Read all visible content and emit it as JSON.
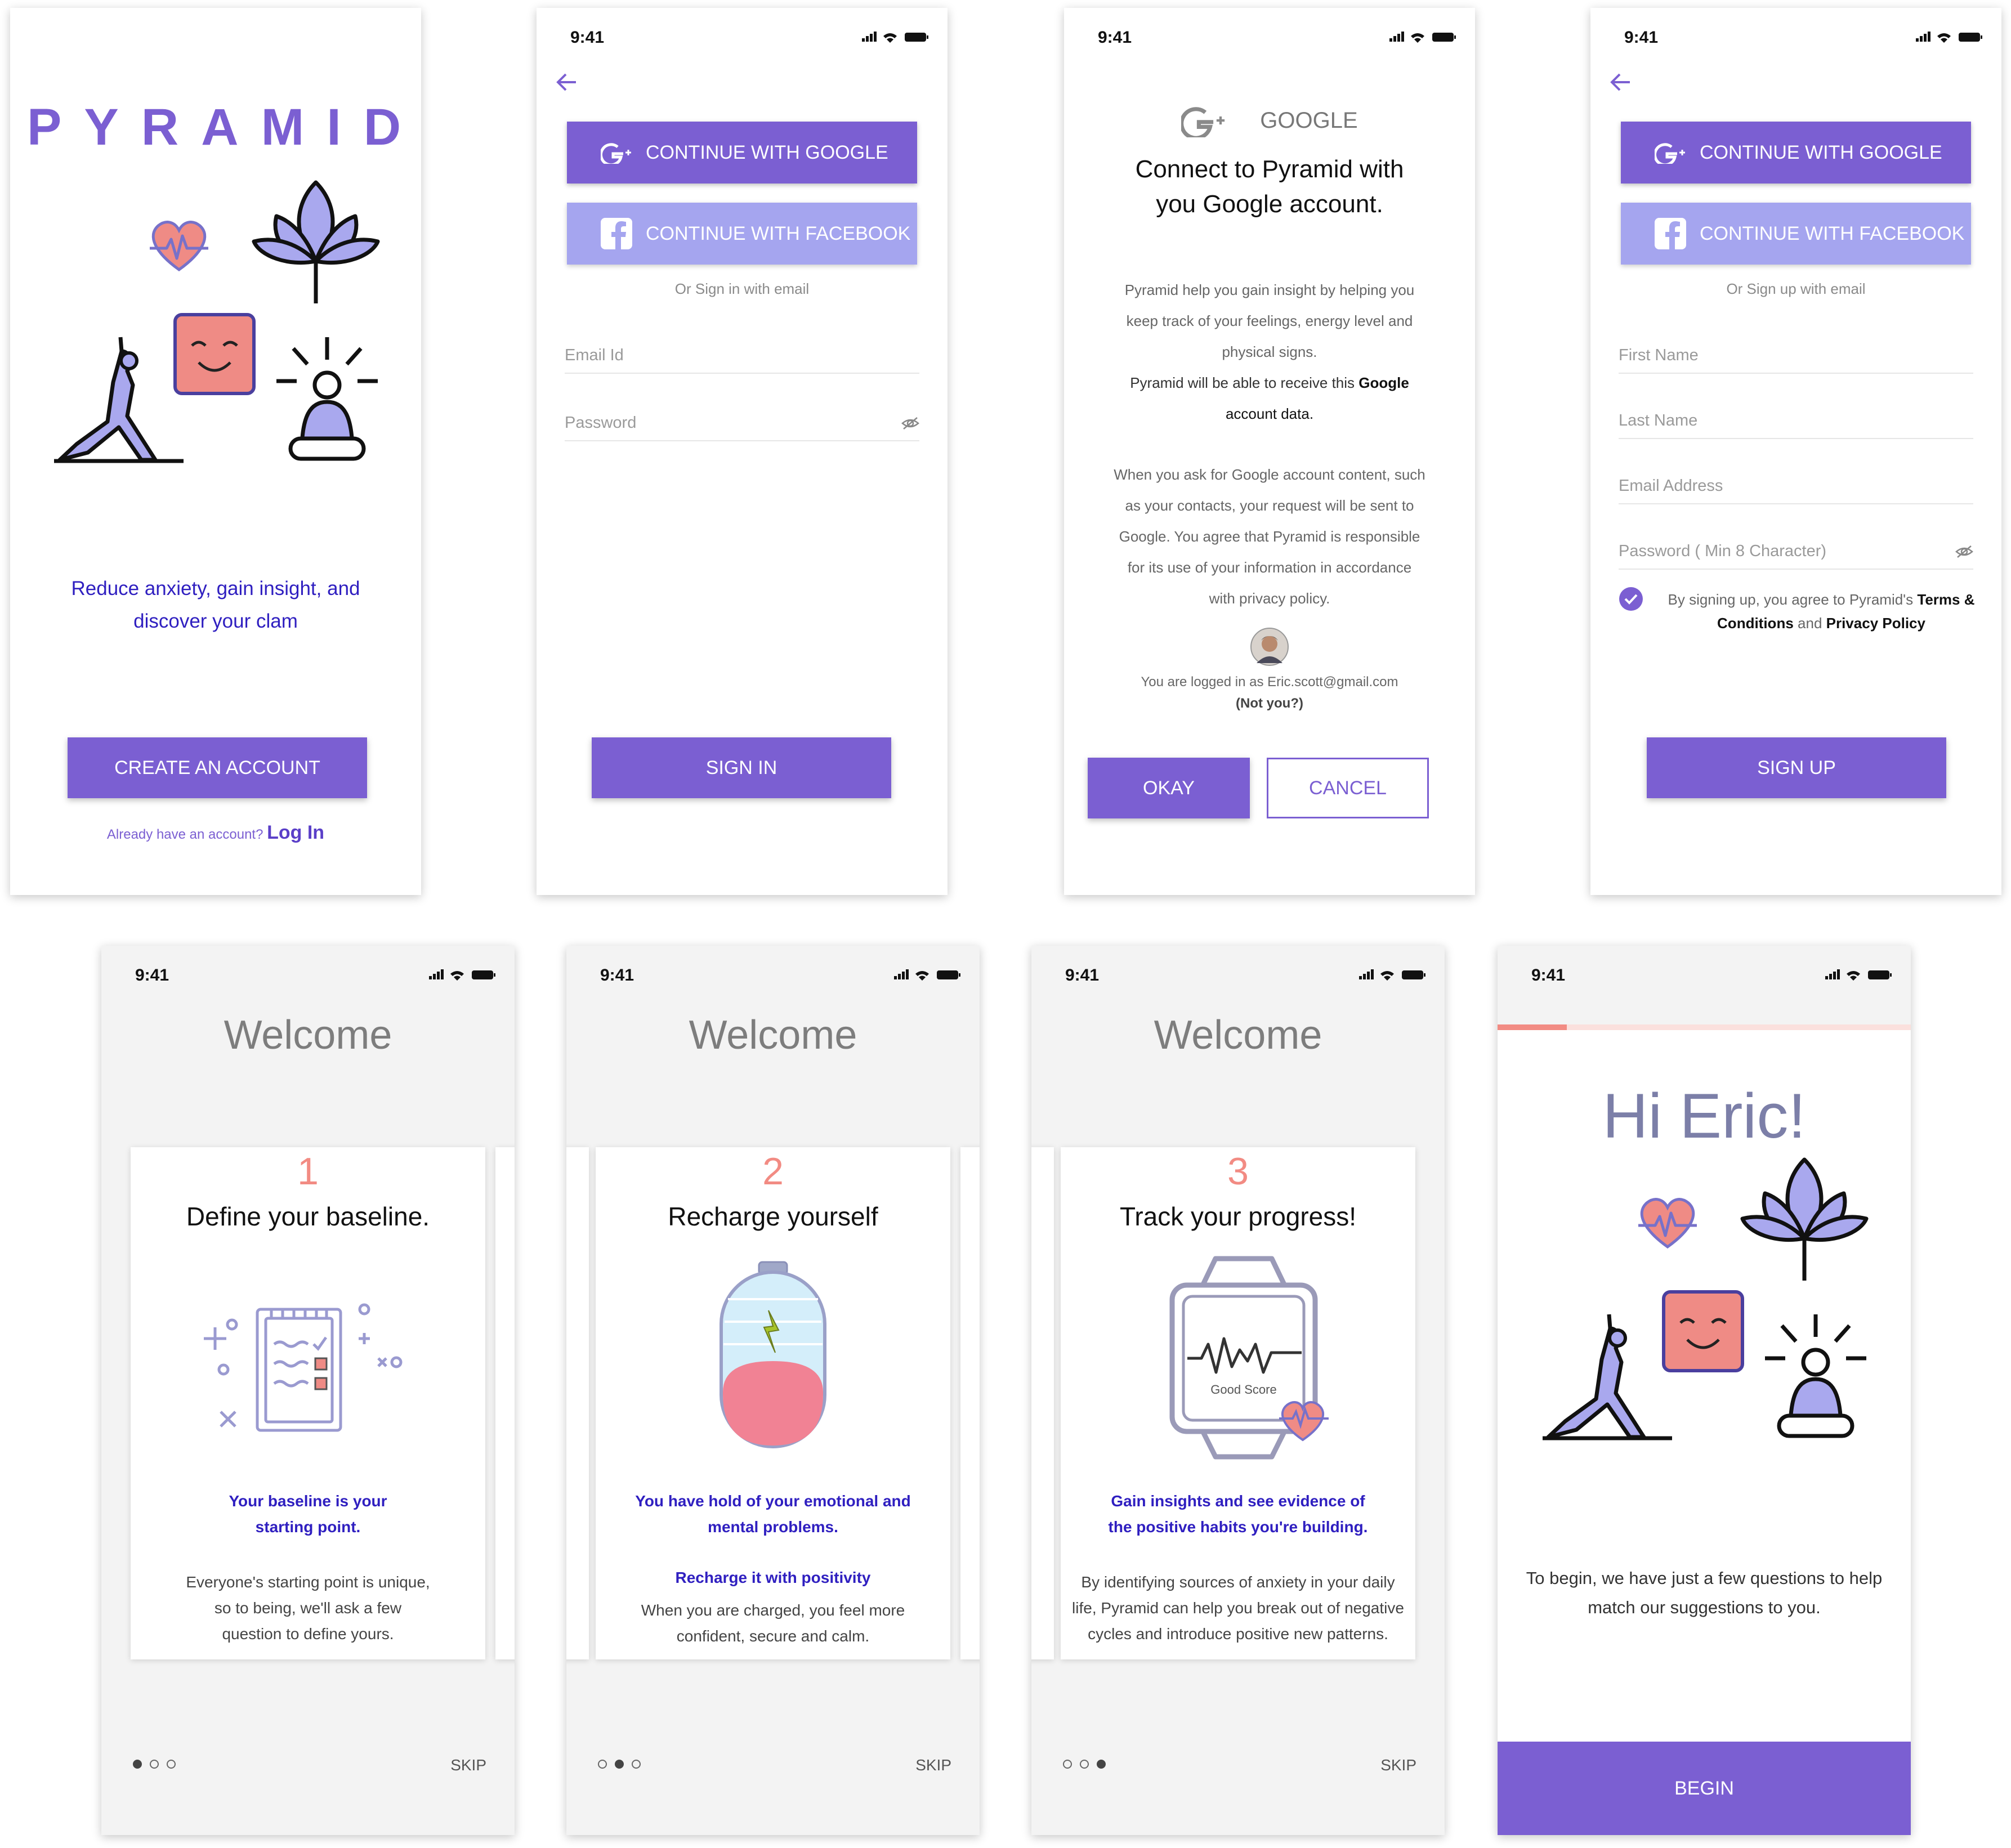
{
  "status": {
    "time": "9:41"
  },
  "onboard": {
    "logo": "PYRAMID",
    "tagline_1": "Reduce anxiety, gain insight, and",
    "tagline_2": "discover your clam",
    "create_btn": "CREATE AN ACCOUNT",
    "have_account": "Already have an account?",
    "login_link": "Log In"
  },
  "signin": {
    "google_btn": "CONTINUE WITH GOOGLE",
    "facebook_btn": "CONTINUE WITH FACEBOOK",
    "or_text": "Or Sign in with email",
    "email_placeholder": "Email Id",
    "password_placeholder": "Password",
    "signin_btn": "SIGN IN"
  },
  "google_consent": {
    "brand": "GOOGLE",
    "title_1": "Connect to Pyramid with",
    "title_2": "you Google account.",
    "p1_l1": "Pyramid help you gain insight by helping you",
    "p1_l2": "keep track of your feelings, energy level and",
    "p1_l3": "physical signs.",
    "p1_l4a": "Pyramid will be able to receive this ",
    "p1_l4b": "Google",
    "p1_l5": "account data.",
    "p2_l1": "When you ask for Google account content, such",
    "p2_l2": "as your contacts, your request will be sent to",
    "p2_l3": "Google. You agree that Pyramid is responsible",
    "p2_l4": "for its use of your information in accordance",
    "p2_l5": "with privacy policy.",
    "logged_in": "You are logged in as Eric.scott@gmail.com",
    "not_you": "(Not you?)",
    "okay_btn": "OKAY",
    "cancel_btn": "CANCEL"
  },
  "signup": {
    "google_btn": "CONTINUE WITH GOOGLE",
    "facebook_btn": "CONTINUE WITH FACEBOOK",
    "or_text": "Or Sign up with email",
    "first_name": "First Name",
    "last_name": "Last Name",
    "email": "Email Address",
    "password": "Password ( Min 8 Character)",
    "terms_a": "By signing up, you agree to Pyramid's ",
    "terms_b": "Terms &",
    "terms_c": "Conditions",
    "terms_d": " and ",
    "terms_e": "Privacy Policy",
    "signup_btn": "SIGN UP"
  },
  "welcome": {
    "heading": "Welcome",
    "skip": "SKIP",
    "card1": {
      "num": "1",
      "title": "Define your baseline.",
      "hl_1": "Your baseline is your",
      "hl_2": "starting point.",
      "b_1": "Everyone's starting point is unique,",
      "b_2": "so to being, we'll ask a few",
      "b_3": "question to define yours."
    },
    "card2": {
      "num": "2",
      "title": "Recharge yourself",
      "hl_1": "You have hold of your emotional and",
      "hl_2": "mental problems.",
      "hl_3": "Recharge it with positivity",
      "b_1": "When you are charged, you feel more",
      "b_2": "confident, secure and calm."
    },
    "card3": {
      "num": "3",
      "title": "Track your progress!",
      "watch_label": "Good Score",
      "hl_1": "Gain insights and see evidence of",
      "hl_2": "the positive habits you're building.",
      "b_1": "By identifying sources of anxiety in your daily",
      "b_2": "life, Pyramid can help you break out of negative",
      "b_3": "cycles and introduce positive new patterns."
    }
  },
  "hello": {
    "greeting": "Hi Eric!",
    "intro_1": "To begin, we have just a few questions to help",
    "intro_2": "match our suggestions to you.",
    "begin_btn": "BEGIN",
    "progress": 0.167
  },
  "colors": {
    "primary": "#7b5fd2",
    "facebook": "#a5a5ef",
    "accent": "#f28b83",
    "link": "#2f1fc0"
  }
}
